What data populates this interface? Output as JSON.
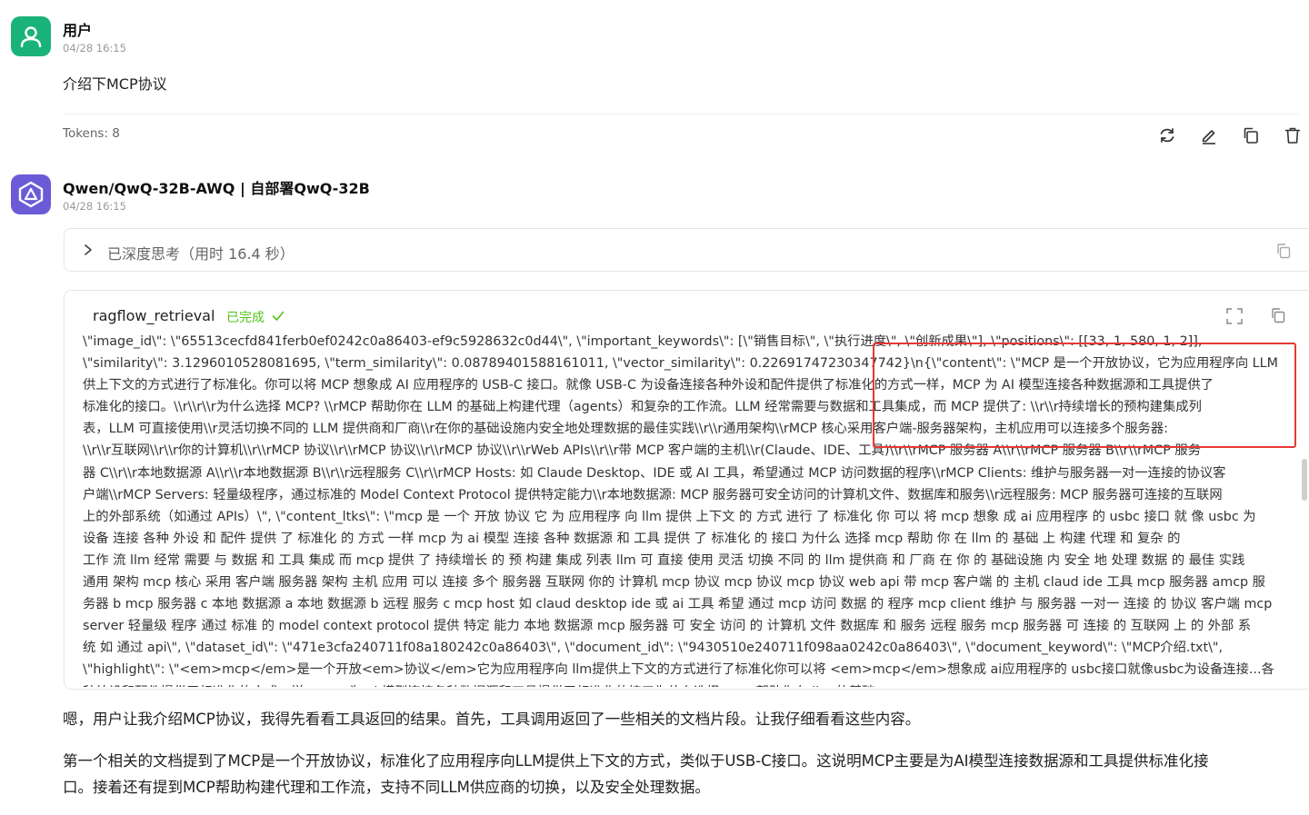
{
  "user": {
    "name": "用户",
    "time": "04/28 16:15",
    "message": "介绍下MCP协议",
    "tokens": "Tokens: 8"
  },
  "assistant": {
    "name": "Qwen/QwQ-32B-AWQ | 自部署QwQ-32B",
    "time": "04/28 16:15",
    "thinking_label": "已深度思考（用时 16.4 秒）",
    "tool": {
      "name": "ragflow_retrieval",
      "status": "已完成",
      "lines": [
        "\\\"image_id\\\": \\\"65513cecfd841ferb0ef0242c0a86403-ef9c5928632c0d44\\\", \\\"important_keywords\\\": [\\\"销售目标\\\", \\\"执行进度\\\", \\\"创新成果\\\"], \\\"positions\\\": [[33, 1, 580, 1, 2]],",
        "\\\"similarity\\\": 3.1296010528081695, \\\"term_similarity\\\": 0.08789401588161011, \\\"vector_similarity\\\": 0.22691747230347742}\\n{\\\"content\\\": \\\"MCP 是一个开放协议，它为应用程序向 LLM 提",
        "供上下文的方式进行了标准化。你可以将 MCP 想象成 AI 应用程序的 USB-C 接口。就像 USB-C 为设备连接各种外设和配件提供了标准化的方式一样，MCP 为 AI 模型连接各种数据源和工具提供了",
        "标准化的接口。\\\\r\\\\r\\\\r为什么选择 MCP? \\\\rMCP 帮助你在 LLM 的基础上构建代理（agents）和复杂的工作流。LLM 经常需要与数据和工具集成，而 MCP 提供了: \\\\r\\\\r持续增长的预构建集成列",
        "表，LLM 可直接使用\\\\r灵活切换不同的 LLM 提供商和厂商\\\\r在你的基础设施内安全地处理数据的最佳实践\\\\r\\\\r通用架构\\\\rMCP 核心采用客户端-服务器架构，主机应用可以连接多个服务器:",
        "\\\\r\\\\r互联网\\\\r\\\\r你的计算机\\\\r\\\\rMCP 协议\\\\r\\\\rMCP 协议\\\\r\\\\rMCP 协议\\\\r\\\\rWeb APIs\\\\r\\\\r带 MCP 客户端的主机\\\\r(Claude、IDE、工具)\\\\r\\\\rMCP 服务器 A\\\\r\\\\rMCP 服务器 B\\\\r\\\\rMCP 服务",
        "器 C\\\\r\\\\r本地数据源 A\\\\r\\\\r本地数据源 B\\\\r\\\\r远程服务 C\\\\r\\\\rMCP Hosts: 如 Claude Desktop、IDE 或 AI 工具，希望通过 MCP 访问数据的程序\\\\rMCP Clients: 维护与服务器一对一连接的协议客",
        "户端\\\\rMCP Servers: 轻量级程序，通过标准的 Model Context Protocol 提供特定能力\\\\r本地数据源: MCP 服务器可安全访问的计算机文件、数据库和服务\\\\r远程服务: MCP 服务器可连接的互联网",
        "上的外部系统（如通过 APIs）\\\", \\\"content_ltks\\\": \\\"mcp 是 一个 开放 协议 它 为 应用程序 向 llm 提供 上下文 的 方式 进行 了 标准化 你 可以 将 mcp 想象 成 ai 应用程序 的 usbc 接口 就 像 usbc 为",
        "设备 连接 各种 外设 和 配件 提供 了 标准化 的 方式 一样 mcp 为 ai 模型 连接 各种 数据源 和 工具 提供 了 标准化 的 接口 为什么 选择 mcp 帮助 你 在 llm 的 基础 上 构建 代理 和 复杂 的",
        "工作 流 llm 经常 需要 与 数据 和 工具 集成 而 mcp 提供 了 持续增长 的 预 构建 集成 列表 llm 可 直接 使用 灵活 切换 不同 的 llm 提供商 和 厂商 在 你 的 基础设施 内 安全 地 处理 数据 的 最佳 实践",
        "通用 架构 mcp 核心 采用 客户端 服务器 架构 主机 应用 可以 连接 多个 服务器 互联网 你的 计算机 mcp 协议 mcp 协议 mcp 协议 web api 带 mcp 客户端 的 主机 claud ide 工具 mcp 服务器 amcp 服",
        "务器 b mcp 服务器 c 本地 数据源 a 本地 数据源 b 远程 服务 c mcp host 如 claud desktop ide 或 ai 工具 希望 通过 mcp 访问 数据 的 程序 mcp client 维护 与 服务器 一对一 连接 的 协议 客户端 mcp",
        "server 轻量级 程序 通过 标准 的 model context protocol 提供 特定 能力 本地 数据源 mcp 服务器 可 安全 访问 的 计算机 文件 数据库 和 服务 远程 服务 mcp 服务器 可 连接 的 互联网 上 的 外部 系",
        "统 如 通过 api\\\", \\\"dataset_id\\\": \\\"471e3cfa240711f08a180242c0a86403\\\", \\\"document_id\\\": \\\"9430510e240711f098aa0242c0a86403\\\", \\\"document_keyword\\\": \\\"MCP介绍.txt\\\",",
        "\\\"highlight\\\": \\\"<em>mcp</em>是一个开放<em>协议</em>它为应用程序向 llm提供上下文的方式进行了标准化你可以将 <em>mcp</em>想象成 ai应用程序的 usbc接口就像usbc为设备连接...各",
        "种外设和配件提供了标准化的方式一样，mcp 为 ai 模型连接各种数据源和工具提供了标准化的接口为什么选择 mcp 帮助你在 llm 的基础..."
      ]
    },
    "answer_p1": "嗯，用户让我介绍MCP协议，我得先看看工具返回的结果。首先，工具调用返回了一些相关的文档片段。让我仔细看看这些内容。",
    "answer_p2_line1": "第一个相关的文档提到了MCP是一个开放协议，标准化了应用程序向LLM提供上下文的方式，类似于USB-C接口。这说明MCP主要是为AI模型连接数据源和工具提供标准化接",
    "answer_p2_line2": "口。接着还有提到MCP帮助构建代理和工作流，支持不同LLM供应商的切换，以及安全处理数据。"
  },
  "colors": {
    "user_avatar": "#19b37a",
    "model_avatar": "#6b5bd6",
    "status_green": "#52c41a",
    "highlight_red": "#e53935"
  },
  "icons": [
    "user-icon",
    "qwen-logo-icon",
    "refresh-icon",
    "edit-icon",
    "copy-icon",
    "trash-icon",
    "chevron-right-icon",
    "expand-icon",
    "check-icon"
  ]
}
